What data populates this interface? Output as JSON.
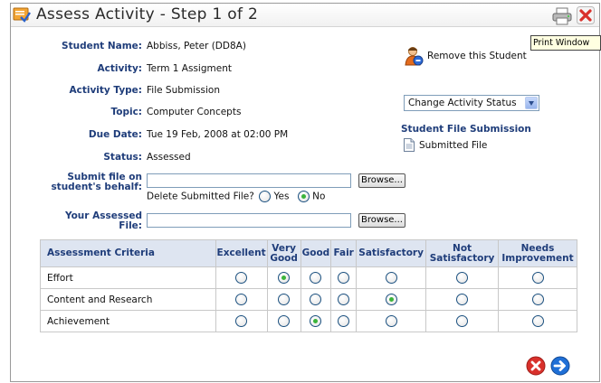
{
  "window": {
    "title": "Assess Activity - Step 1 of 2",
    "tooltip": "Print Window"
  },
  "fields": {
    "student_name_label": "Student Name:",
    "student_name": "Abbiss, Peter (DD8A)",
    "activity_label": "Activity:",
    "activity": "Term 1 Assigment",
    "activity_type_label": "Activity Type:",
    "activity_type": "File Submission",
    "topic_label": "Topic:",
    "topic": "Computer Concepts",
    "due_date_label": "Due Date:",
    "due_date": "Tue 19 Feb, 2008 at 02:00 PM",
    "status_label": "Status:",
    "status": "Assessed"
  },
  "upload": {
    "submit_label_line1": "Submit file on",
    "submit_label_line2": "student's behalf:",
    "submit_value": "",
    "browse_label": "Browse...",
    "delete_question": "Delete Submitted File?",
    "yes_label": "Yes",
    "no_label": "No",
    "delete_selected": "No",
    "assessed_label_line1": "Your Assessed",
    "assessed_label_line2": "File:",
    "assessed_value": ""
  },
  "side": {
    "remove_student": "Remove this Student",
    "change_status": "Change Activity Status",
    "file_submission_heading": "Student File Submission",
    "submitted_file": "Submitted File"
  },
  "criteria_table": {
    "header_criteria": "Assessment Criteria",
    "columns": [
      {
        "line1": "Excellent",
        "line2": ""
      },
      {
        "line1": "Very",
        "line2": "Good"
      },
      {
        "line1": "Good",
        "line2": ""
      },
      {
        "line1": "Fair",
        "line2": ""
      },
      {
        "line1": "Satisfactory",
        "line2": ""
      },
      {
        "line1": "Not",
        "line2": "Satisfactory"
      },
      {
        "line1": "Needs",
        "line2": "Improvement"
      }
    ],
    "rows": [
      {
        "name": "Effort",
        "selected": "Very Good"
      },
      {
        "name": "Content and Research",
        "selected": "Satisfactory"
      },
      {
        "name": "Achievement",
        "selected": "Good"
      }
    ]
  },
  "icons": {
    "title": "assess-activity-icon",
    "print": "printer-icon",
    "close": "close-icon",
    "remove_student": "person-remove-icon",
    "file": "document-icon",
    "cancel": "cancel-icon",
    "next": "next-arrow-icon"
  },
  "colors": {
    "label": "#1f3d7a",
    "table_header_bg": "#dee5f1",
    "radio_selected": "#3bb43b",
    "close_red": "#d9302b",
    "next_blue": "#1f6fd6"
  }
}
